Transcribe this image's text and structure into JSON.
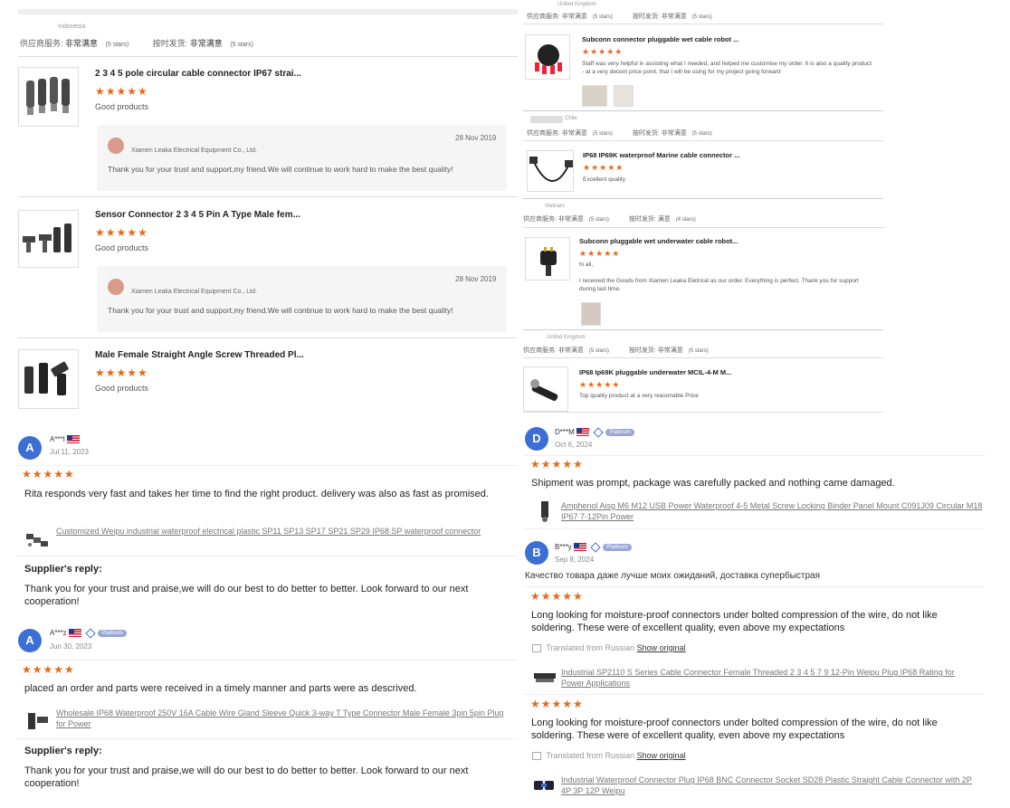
{
  "left_top": {
    "country": "Indonesia",
    "rating_line": {
      "service_label": "供应商服务:",
      "service_value": "非常满意",
      "service_stars": "(5 stars)",
      "ship_label": "按时发货:",
      "ship_value": "非常满意",
      "ship_stars": "(5 stars)"
    },
    "items": [
      {
        "title": "2 3 4 5 pole circular cable connector IP67 strai...",
        "stars": "★★★★★",
        "comment": "Good products",
        "reply": {
          "company": "Xiamen Leaka Electrical Equipment Co., Ltd.",
          "date": "28 Nov 2019",
          "text": "Thank you for your trust and support,my friend.We will continue to work hard to make the best quality!"
        }
      },
      {
        "title": "Sensor Connector 2 3 4 5 Pin A Type Male fem...",
        "stars": "★★★★★",
        "comment": "Good products",
        "reply": {
          "company": "Xiamen Leaka Electrical Equipment Co., Ltd.",
          "date": "28 Nov 2019",
          "text": "Thank you for your trust and support,my friend.We will continue to work hard to make the best quality!"
        }
      },
      {
        "title": "Male Female Straight Angle Screw Threaded Pl...",
        "stars": "★★★★★",
        "comment": "Good products"
      }
    ]
  },
  "right_top": {
    "blocks": [
      {
        "country": "United Kingdom",
        "service_label": "供应商服务:",
        "service_value": "非常满意",
        "service_stars": "(5 stars)",
        "ship_label": "按时发货:",
        "ship_value": "非常满意",
        "ship_stars": "(5 stars)",
        "title": "Subconn connector pluggable wet cable robot ...",
        "stars": "★★★★★",
        "comment": "Staff was very helpful in assisting what I needed, and helped me customise my order. It is also a quality product - at a very decent price point, that I will be using for my project going forward"
      },
      {
        "country": "Chile",
        "service_label": "供应商服务:",
        "service_value": "非常满意",
        "service_stars": "(5 stars)",
        "ship_label": "按时发货:",
        "ship_value": "非常满意",
        "ship_stars": "(5 stars)",
        "title": "IP68 IP69K waterproof Marine cable connector ...",
        "stars": "★★★★★",
        "comment": "Excellent quality"
      },
      {
        "country": "Vietnam",
        "service_label": "供应商服务:",
        "service_value": "非常满意",
        "service_stars": "(5 stars)",
        "ship_label": "按时发货:",
        "ship_value": "满意",
        "ship_stars": "(4 stars)",
        "title": "Subconn pluggable wet underwater cable robot...",
        "stars": "★★★★★",
        "comment_line1": "hi all,",
        "comment_line2": "I received the Goods from Xiamen Leaka Eletrical as our order. Everything is perfect. Thank you for support during last time."
      },
      {
        "country": "United Kingdom",
        "service_label": "供应商服务:",
        "service_value": "非常满意",
        "service_stars": "(5 stars)",
        "ship_label": "按时发货:",
        "ship_value": "非常满意",
        "ship_stars": "(5 stars)",
        "title": "IP68 Ip69K pluggable underwater MCIL-4-M M...",
        "stars": "★★★★★",
        "comment": "Top quality product at a very reasonable Price"
      }
    ]
  },
  "left_bottom": {
    "reviews": [
      {
        "avatar_letter": "A",
        "avatar_color": "#3b6fd4",
        "name": "A***I",
        "date": "Jul 11, 2023",
        "stars": "★★★★★",
        "text": "Rita responds very fast and takes her time to find the right product. delivery was also as fast as promised.",
        "product_link": "Customized Weipu industrial waterproof electrical plastic SP11 SP13 SP17 SP21 SP29 IP68 SP waterproof connector",
        "reply_label": "Supplier's reply:",
        "reply_text": "Thank you for your trust and praise,we will do our best to do better to better. Look forward to our next cooperation!"
      },
      {
        "avatar_letter": "A",
        "avatar_color": "#3b6fd4",
        "name": "A***z",
        "badge": "Platinum",
        "date": "Jun 30, 2023",
        "stars": "★★★★★",
        "text": "placed an order and parts were received in a timely manner and parts were as descrived.",
        "product_link": "Wholesale IP68 Waterproof 250V 16A Cable Wire Gland Sleeve Quick 3-way T Type Connector Male Female 3pin 5pin Plug for Power",
        "reply_label": "Supplier's reply:",
        "reply_text": "Thank you for your trust and praise,we will do our best to do better to better. Look forward to our next cooperation!"
      }
    ]
  },
  "right_bottom": {
    "reviews": [
      {
        "avatar_letter": "D",
        "avatar_color": "#3b6fd4",
        "name": "D***M",
        "badge": "Platinum",
        "date": "Oct 6, 2024",
        "stars": "★★★★★",
        "text": "Shipment was prompt, package was carefully packed and nothing came damaged.",
        "product_link": "Amphenol Aisg M6 M12 USB Power Waterproof 4-5 Metal Screw Locking Binder Panel Mount C091J09 Circular M18 IP67 7-12Pin Power"
      },
      {
        "avatar_letter": "B",
        "avatar_color": "#3b6fd4",
        "name": "B***y",
        "badge": "Platinum",
        "date": "Sep 8, 2024",
        "original_text": "Качество товара даже лучше моих ожиданий, доставка супербыстрая",
        "stars": "★★★★★",
        "text": "Long looking for moisture-proof connectors under bolted compression of the wire, do not like soldering. These were of excellent quality, even above my expectations",
        "translated_label": "Translated from Russian",
        "show_original": "Show original",
        "product_link": "Industrial SP2110 S Series Cable Connector Female Threaded 2 3 4 5 7 9 12-Pin Weipu Plug IP68 Rating for Power Applications",
        "stars2": "★★★★★",
        "text2": "Long looking for moisture-proof connectors under bolted compression of the wire, do not like soldering. These were of excellent quality, even above my expectations",
        "translated_label2": "Translated from Russian",
        "show_original2": "Show original",
        "product_link2": "Industrial Waterproof Connector Plug IP68 BNC Connector Socket SD28 Plastic Straight Cable Connector with 2P 4P 3P 12P Weipu"
      }
    ]
  }
}
